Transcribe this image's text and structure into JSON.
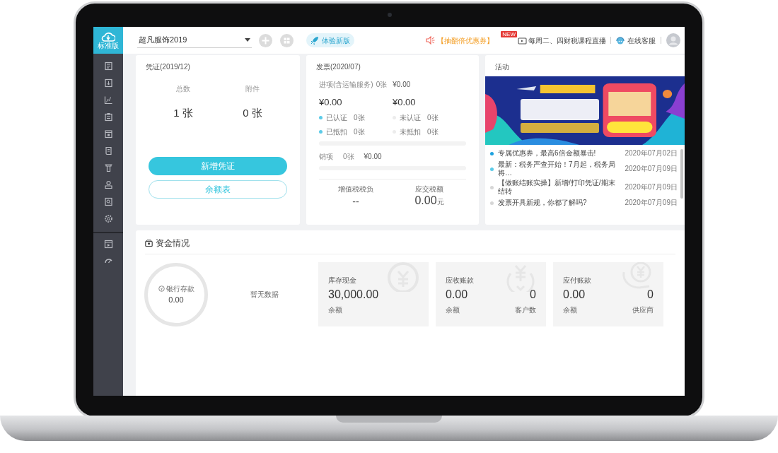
{
  "app": {
    "edition": "标准版"
  },
  "topbar": {
    "company": "超凡服饰2019",
    "new_version": "体验新版",
    "promo": "【抽翻倍优惠券】",
    "new_badge": "NEW",
    "live": "每周二、四财税课程直播",
    "support": "在线客服"
  },
  "voucher": {
    "title": "凭证(2019/12)",
    "stats": [
      {
        "label": "总数",
        "value": "1 张"
      },
      {
        "label": "附件",
        "value": "0 张"
      }
    ],
    "buttons": [
      {
        "label": "新增凭证",
        "kind": "primary"
      },
      {
        "label": "余额表",
        "kind": "outline"
      }
    ]
  },
  "invoice": {
    "title": "发票(2020/07)",
    "input": {
      "label": "进项(含运输服务)",
      "count": "0张",
      "amount": "¥0.00"
    },
    "amounts": [
      "¥0.00",
      "¥0.00"
    ],
    "statuses": [
      {
        "label": "已认证",
        "count": "0张",
        "color": "#5ccbe8"
      },
      {
        "label": "未认证",
        "count": "0张",
        "color": "#ececec"
      },
      {
        "label": "已抵扣",
        "count": "0张",
        "color": "#5ccbe8"
      },
      {
        "label": "未抵扣",
        "count": "0张",
        "color": "#ececec"
      }
    ],
    "output": {
      "label": "销项",
      "count": "0张",
      "amount": "¥0.00"
    },
    "tax_burden": {
      "label": "增值税税负",
      "value": "--"
    },
    "tax_due": {
      "label": "应交税额",
      "value": "0.00",
      "unit": "元"
    }
  },
  "activity": {
    "title": "活动",
    "news": [
      {
        "text": "专属优惠券，最高6倍金额暴击!",
        "date": "2020年07月02日",
        "color": "#1ea2df"
      },
      {
        "text": "最新：税务严查开始！7月起，税务局将…",
        "date": "2020年07月09日",
        "color": "#5ccbe8"
      },
      {
        "text": "【做账结账实操】新增/打印凭证/期末结转",
        "date": "2020年07月09日",
        "color": "#d6d6d6"
      },
      {
        "text": "发票开具新规，你都了解吗?",
        "date": "2020年07月09日",
        "color": "#d6d6d6"
      }
    ]
  },
  "funds": {
    "title": "资金情况",
    "bank": {
      "label": "银行存款",
      "value": "0.00"
    },
    "empty": "暂无数据",
    "tiles": [
      {
        "title": "库存现金",
        "value": "30,000.00",
        "sub": "余额"
      },
      {
        "title": "应收账款",
        "value": "0.00",
        "sub": "余额",
        "count": "0",
        "count_label": "客户数"
      },
      {
        "title": "应付账款",
        "value": "0.00",
        "sub": "余额",
        "count": "0",
        "count_label": "供应商"
      }
    ]
  }
}
